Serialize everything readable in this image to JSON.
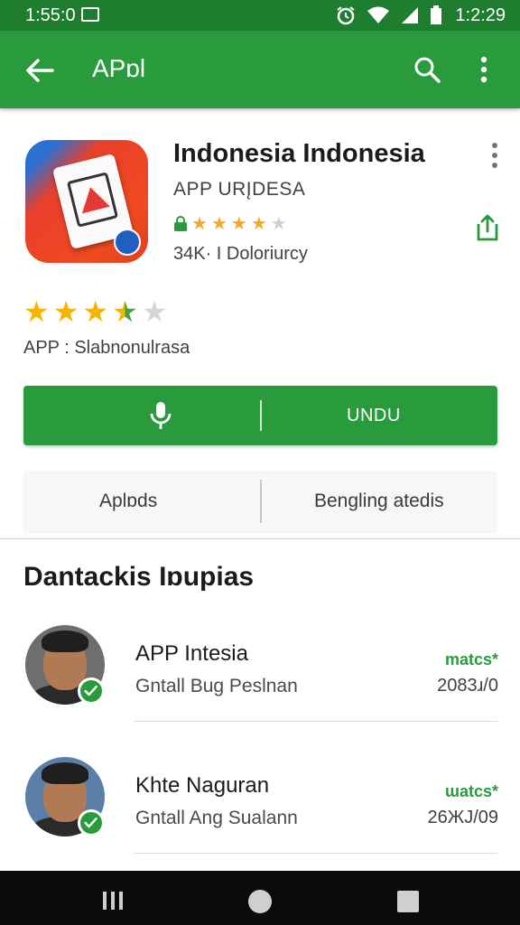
{
  "status_bar": {
    "time_left": "1:55:0",
    "time_right": "1:2:29",
    "icons": [
      "image-icon",
      "alarm-icon",
      "wifi-icon",
      "signal-icon",
      "battery-icon"
    ]
  },
  "app_bar": {
    "title": "APɒl",
    "icons": [
      "back-arrow-icon",
      "search-icon",
      "more-vert-icon"
    ]
  },
  "app": {
    "name": "Indonesia Indonesia",
    "developer": "APP URĮDESA",
    "mini_rating": {
      "stars_filled": 4,
      "stars_total": 5
    },
    "downloads": "34K· I Doloriurcy",
    "icons": [
      "app-logo-icon",
      "more-vert-icon",
      "share-icon",
      "lock-icon"
    ]
  },
  "rating": {
    "value": 3.5,
    "stars_total": 5,
    "caption": "APP : Slabnonulrasa"
  },
  "install_button": {
    "label": "UNDU",
    "icon": "mic-icon"
  },
  "tabs": [
    {
      "label": "Aplɒds"
    },
    {
      "label": "Bengling atedis"
    }
  ],
  "section": {
    "title": "Dantackis Iɒupias"
  },
  "developers": [
    {
      "name": "APP Intesia",
      "subtitle": "Gntall Bug Peslnan",
      "tag": "matcs*",
      "date": "2083ɹ/0"
    },
    {
      "name": "Khte Naguran",
      "subtitle": "Gntall Ang Sualann",
      "tag": "ɯatcs*",
      "date": "26ЖJ/09"
    }
  ],
  "colors": {
    "brand_green": "#2a9b3d",
    "status_green": "#1e7d2f",
    "star_gold": "#f5b400"
  }
}
